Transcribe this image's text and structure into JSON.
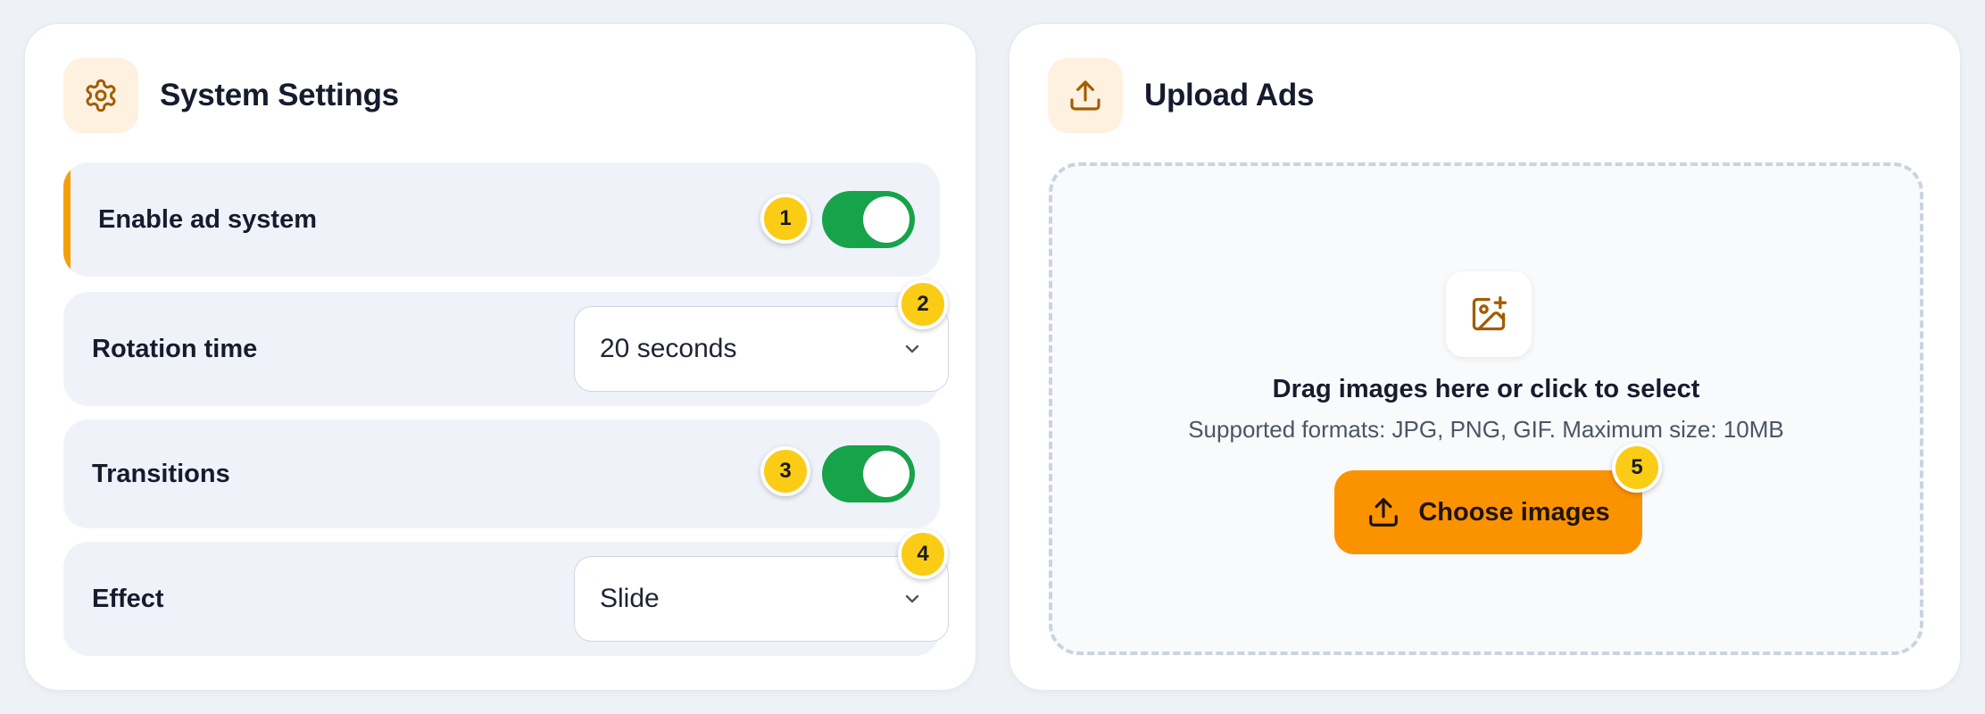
{
  "settings": {
    "title": "System Settings",
    "icon": "gear-icon",
    "rows": [
      {
        "label": "Enable ad system",
        "control": "toggle",
        "on": true,
        "badge": "1"
      },
      {
        "label": "Rotation time",
        "control": "select",
        "value": "20 seconds",
        "badge": "2"
      },
      {
        "label": "Transitions",
        "control": "toggle",
        "on": true,
        "badge": "3"
      },
      {
        "label": "Effect",
        "control": "select",
        "value": "Slide",
        "badge": "4"
      }
    ]
  },
  "upload": {
    "title": "Upload Ads",
    "icon": "upload-icon",
    "dropzone": {
      "icon": "image-plus-icon",
      "title": "Drag images here or click to select",
      "subtitle": "Supported formats: JPG, PNG, GIF. Maximum size: 10MB"
    },
    "button": {
      "label": "Choose images",
      "icon": "upload-icon",
      "badge": "5"
    }
  },
  "colors": {
    "accent": "#f59e0b",
    "toggle_on": "#16a34a",
    "button": "#fb9300",
    "badge": "#facc15",
    "icon_brown": "#a35c00"
  }
}
